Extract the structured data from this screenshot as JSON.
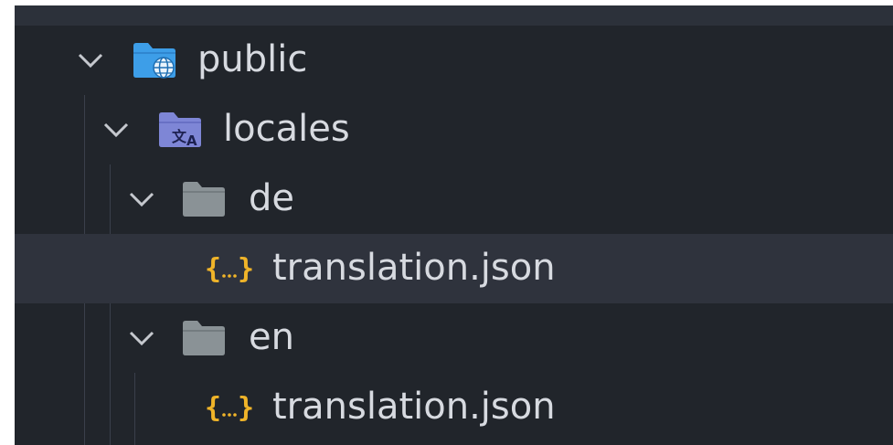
{
  "explorer": {
    "items": [
      {
        "label": "public",
        "type": "folder",
        "expanded": true,
        "icon": "folder-public-icon"
      },
      {
        "label": "locales",
        "type": "folder",
        "expanded": true,
        "icon": "folder-locales-icon"
      },
      {
        "label": "de",
        "type": "folder",
        "expanded": true,
        "icon": "folder-icon"
      },
      {
        "label": "translation.json",
        "type": "file",
        "selected": true,
        "icon": "json-file-icon"
      },
      {
        "label": "en",
        "type": "folder",
        "expanded": true,
        "icon": "folder-icon"
      },
      {
        "label": "translation.json",
        "type": "file",
        "icon": "json-file-icon"
      }
    ]
  },
  "colors": {
    "background": "#21252b",
    "selected_row": "#2f333d",
    "text": "#d7dae0",
    "public_folder": "#3d9ee8",
    "locales_folder": "#7e86d6",
    "plain_folder": "#8a9296",
    "json_braces": "#f0b429"
  }
}
